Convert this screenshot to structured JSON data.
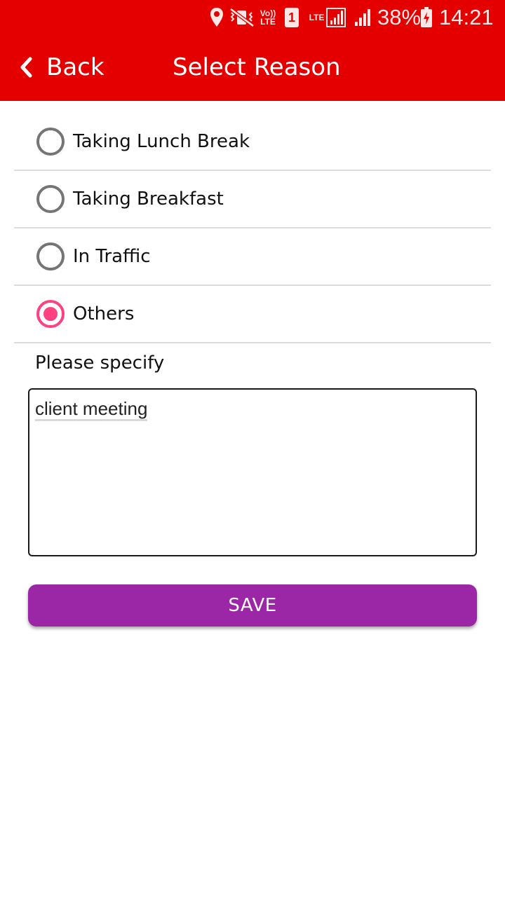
{
  "status_bar": {
    "volte_label": "Vo)) LTE",
    "sim_label": "1",
    "network_label": "LTE",
    "battery_percent": "38%",
    "time": "14:21"
  },
  "toolbar": {
    "back_label": "Back",
    "title": "Select Reason"
  },
  "reasons": [
    {
      "label": "Taking Lunch Break",
      "selected": false
    },
    {
      "label": "Taking Breakfast",
      "selected": false
    },
    {
      "label": "In Traffic",
      "selected": false
    },
    {
      "label": "Others",
      "selected": true
    }
  ],
  "specify": {
    "label": "Please specify",
    "value": "client meeting"
  },
  "save_label": "SAVE",
  "colors": {
    "toolbar": "#e50000",
    "radio_selected": "#ff4081",
    "save_button": "#9c27a6"
  },
  "icons": [
    "location-icon",
    "vibrate-icon",
    "signal-icon",
    "battery-charging-icon",
    "back-chevron-icon"
  ]
}
